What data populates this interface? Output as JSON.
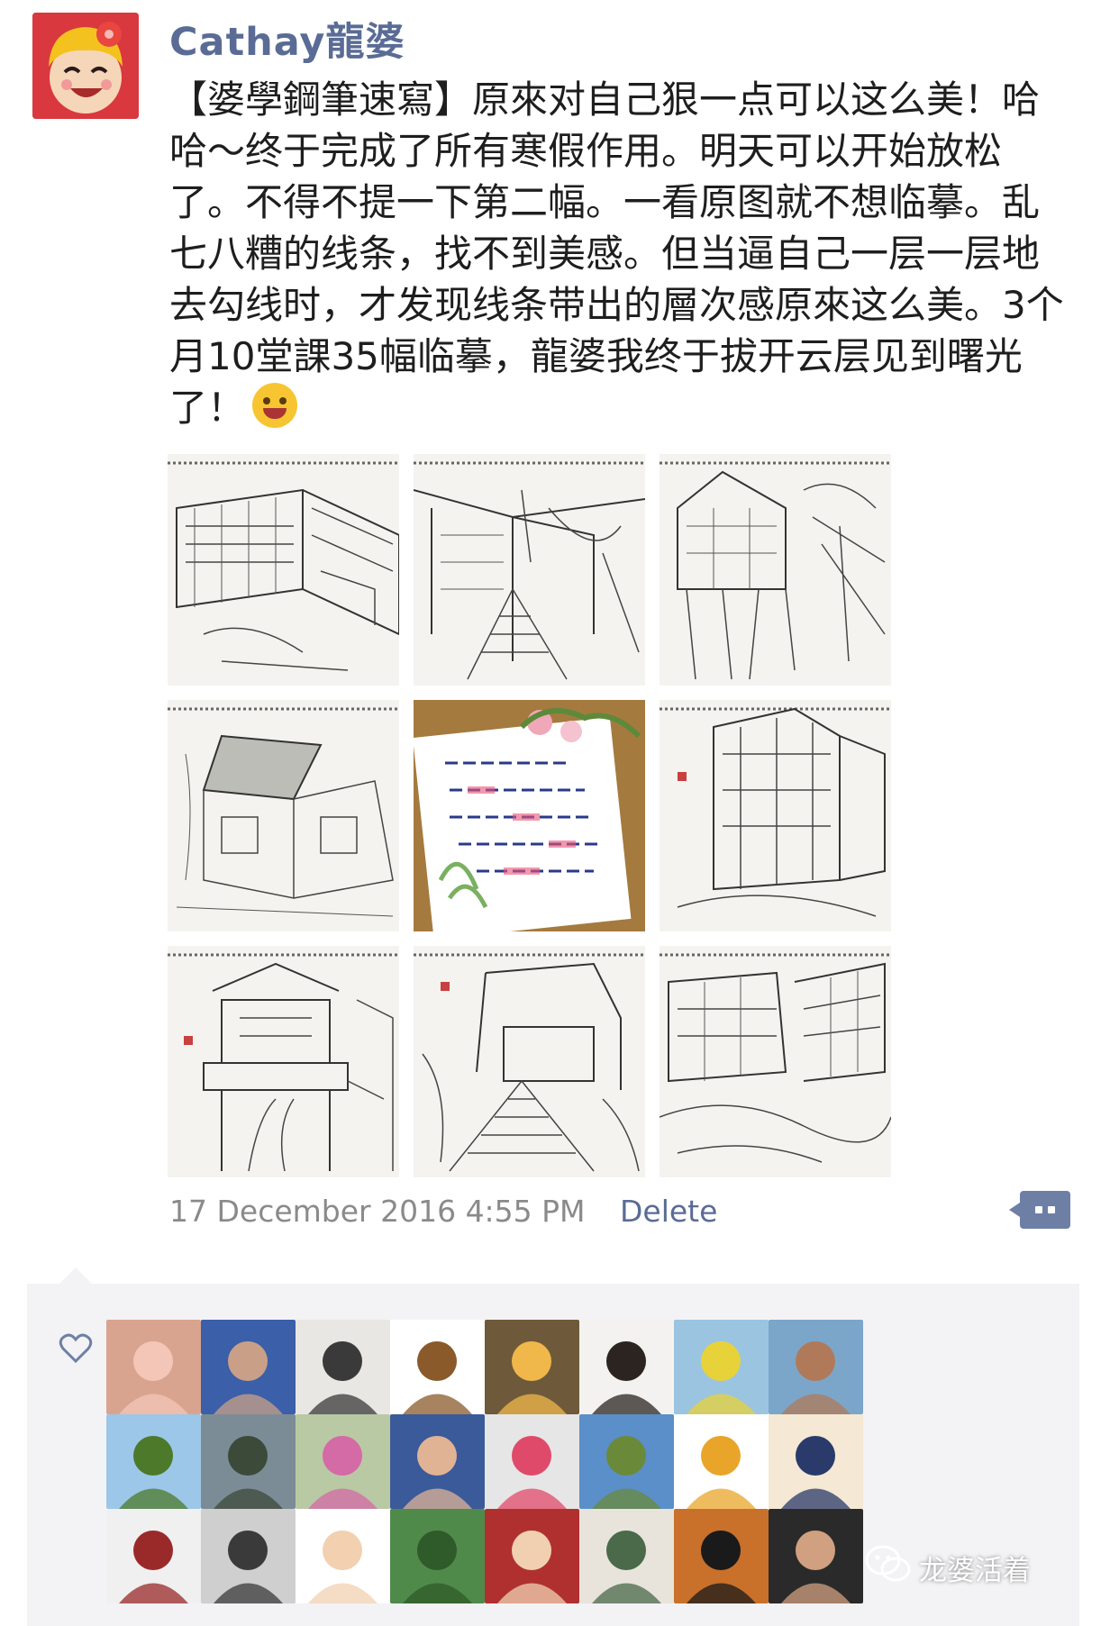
{
  "post": {
    "username": "Cathay龍婆",
    "text": "【婆學鋼筆速寫】原來对自己狠一点可以这么美！哈哈～终于完成了所有寒假作用。明天可以开始放松了。不得不提一下第二幅。一看原图就不想临摹。乱七八糟的线条，找不到美感。但当逼自己一层一层地去勾线时，才发现线条带出的層次感原來这么美。3个月10堂課35幅临摹，龍婆我终于拔开云层见到曙光了！",
    "emoji": "grinning-face-icon",
    "timestamp": "17 December 2016 4:55 PM",
    "delete_label": "Delete"
  },
  "photos": [
    {
      "name": "sketch-village-courtyard"
    },
    {
      "name": "sketch-alley-stairs"
    },
    {
      "name": "sketch-stilt-house"
    },
    {
      "name": "sketch-tiled-roof-house"
    },
    {
      "name": "note-with-flowers"
    },
    {
      "name": "sketch-wooden-tower-house"
    },
    {
      "name": "sketch-pavilion-gate"
    },
    {
      "name": "sketch-stone-staircase"
    },
    {
      "name": "sketch-riverside-houses"
    }
  ],
  "likes": {
    "icon": "heart-icon",
    "avatars": [
      {
        "name": "liker-avatar-pig",
        "color": "#d9a48f",
        "accent": "#f3c6b8"
      },
      {
        "name": "liker-avatar-hat-woman",
        "color": "#3b5fa8",
        "accent": "#c9a087"
      },
      {
        "name": "liker-avatar-standing-woman",
        "color": "#e9e7e3",
        "accent": "#3a3a3a"
      },
      {
        "name": "liker-avatar-cartoon-bird",
        "color": "#ffffff",
        "accent": "#8a5a2b"
      },
      {
        "name": "liker-avatar-sunset",
        "color": "#6e5a3a",
        "accent": "#f0b84a"
      },
      {
        "name": "liker-avatar-girl",
        "color": "#f4f2f0",
        "accent": "#2b2420"
      },
      {
        "name": "liker-avatar-field",
        "color": "#9bc4e0",
        "accent": "#e8d23a"
      },
      {
        "name": "liker-avatar-lake-pose",
        "color": "#7ba6c9",
        "accent": "#b07a5a"
      },
      {
        "name": "liker-avatar-leaves",
        "color": "#9cc7e8",
        "accent": "#4c7a2a"
      },
      {
        "name": "liker-avatar-cliff",
        "color": "#7c8c96",
        "accent": "#3c4a3a"
      },
      {
        "name": "liker-avatar-flowers",
        "color": "#b9c9a3",
        "accent": "#d46aa6"
      },
      {
        "name": "liker-avatar-smiling-woman",
        "color": "#3a5a9a",
        "accent": "#e0b395"
      },
      {
        "name": "liker-avatar-white-cat",
        "color": "#e6e6e6",
        "accent": "#e04a6a"
      },
      {
        "name": "liker-avatar-coast",
        "color": "#5a8fc9",
        "accent": "#6a8a3a"
      },
      {
        "name": "liker-avatar-cartoon-mouse",
        "color": "#ffffff",
        "accent": "#e8a52a"
      },
      {
        "name": "liker-avatar-cartoon-girl",
        "color": "#f5e8d4",
        "accent": "#2a3a6a"
      },
      {
        "name": "liker-avatar-woman-portrait",
        "color": "#f0f0f0",
        "accent": "#9a2a2a"
      },
      {
        "name": "liker-avatar-vintage-photo",
        "color": "#cfcfcf",
        "accent": "#3a3a3a"
      },
      {
        "name": "liker-avatar-cartoon-bun-girl",
        "color": "#ffffff",
        "accent": "#f2d0b0"
      },
      {
        "name": "liker-avatar-lotus-pond",
        "color": "#4f8a4a",
        "accent": "#2f5a2a"
      },
      {
        "name": "liker-avatar-woman-phone",
        "color": "#b03030",
        "accent": "#f0d0b0"
      },
      {
        "name": "liker-avatar-fashion-sketch",
        "color": "#e8e4dc",
        "accent": "#4a6a4a"
      },
      {
        "name": "liker-avatar-bob-hair-cartoon",
        "color": "#c9702a",
        "accent": "#1a1a1a"
      },
      {
        "name": "liker-avatar-dark-portrait",
        "color": "#2a2a2a",
        "accent": "#d0a080"
      }
    ]
  },
  "watermark": "龙婆活着",
  "colors": {
    "link": "#5a6c95",
    "meta": "#8a8a8a",
    "likes_bg": "#f3f3f5"
  }
}
